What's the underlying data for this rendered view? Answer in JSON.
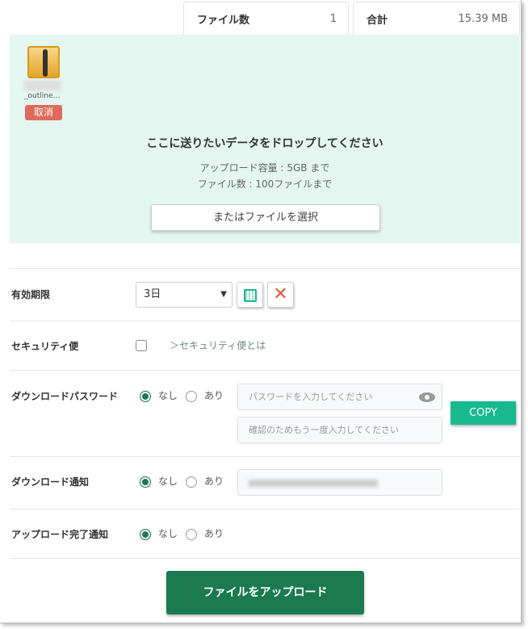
{
  "stats": {
    "file_count_label": "ファイル数",
    "file_count": "1",
    "total_label": "合計",
    "total": "15.39 MB"
  },
  "dropzone": {
    "file_name": "_outline…",
    "cancel": "取消",
    "title": "ここに送りたいデータをドロップしてください",
    "capacity": "アップロード容量 : 5GB まで",
    "max_files": "ファイル数 : 100ファイルまで",
    "select_button": "またはファイルを選択"
  },
  "form": {
    "expiry": {
      "label": "有効期限",
      "value": "3日"
    },
    "security": {
      "label": "セキュリティ便",
      "link": "＞セキュリティ便とは",
      "checked": false
    },
    "password": {
      "label": "ダウンロードパスワード",
      "none": "なし",
      "yes": "あり",
      "selected": "なし",
      "placeholder": "パスワードを入力してください",
      "confirm_placeholder": "確認のためもう一度入力してください",
      "copy": "COPY"
    },
    "download_notify": {
      "label": "ダウンロード通知",
      "none": "なし",
      "yes": "あり",
      "selected": "なし"
    },
    "upload_notify": {
      "label": "アップロード完了通知",
      "none": "なし",
      "yes": "あり",
      "selected": "なし"
    }
  },
  "upload_button": "ファイルをアップロード",
  "colors": {
    "accent": "#1b7a50",
    "copy": "#18b98e",
    "cancel": "#e06a5a",
    "dropzone": "#e3f6f0"
  }
}
